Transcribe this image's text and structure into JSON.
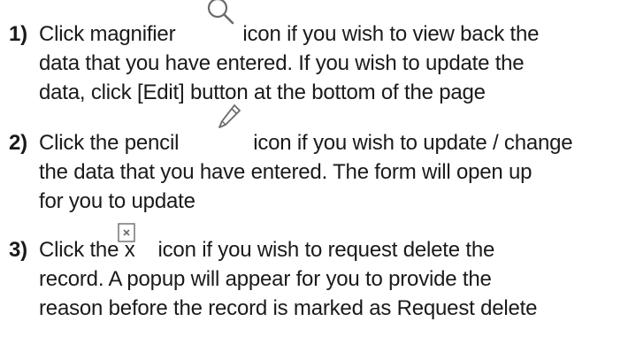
{
  "instructions": {
    "step1": {
      "number": "1)",
      "line1_before_icon": "Click magnifier",
      "line1_after_icon": "icon if you wish to view back the",
      "line2": "data that you have entered. If you wish to update the",
      "line3": "data, click [Edit] button at the bottom of the page",
      "icon": "search-icon"
    },
    "step2": {
      "number": "2)",
      "line1_before_icon": "Click the pencil",
      "line1_after_icon": "icon if you wish to update / change",
      "line2": "the data that you have entered.  The form will open up",
      "line3": "for you to update",
      "icon": "pencil-icon"
    },
    "step3": {
      "number": "3)",
      "line1_before_icon": "Click the x",
      "line1_after_icon": "icon if you wish to request delete the",
      "line2": "record.  A popup will appear for you to provide the",
      "line3": "reason before the record is marked as Request delete",
      "icon": "close-box-icon"
    }
  },
  "colors": {
    "text": "#1a1a1a",
    "icon_stroke": "#6b6b6b"
  }
}
